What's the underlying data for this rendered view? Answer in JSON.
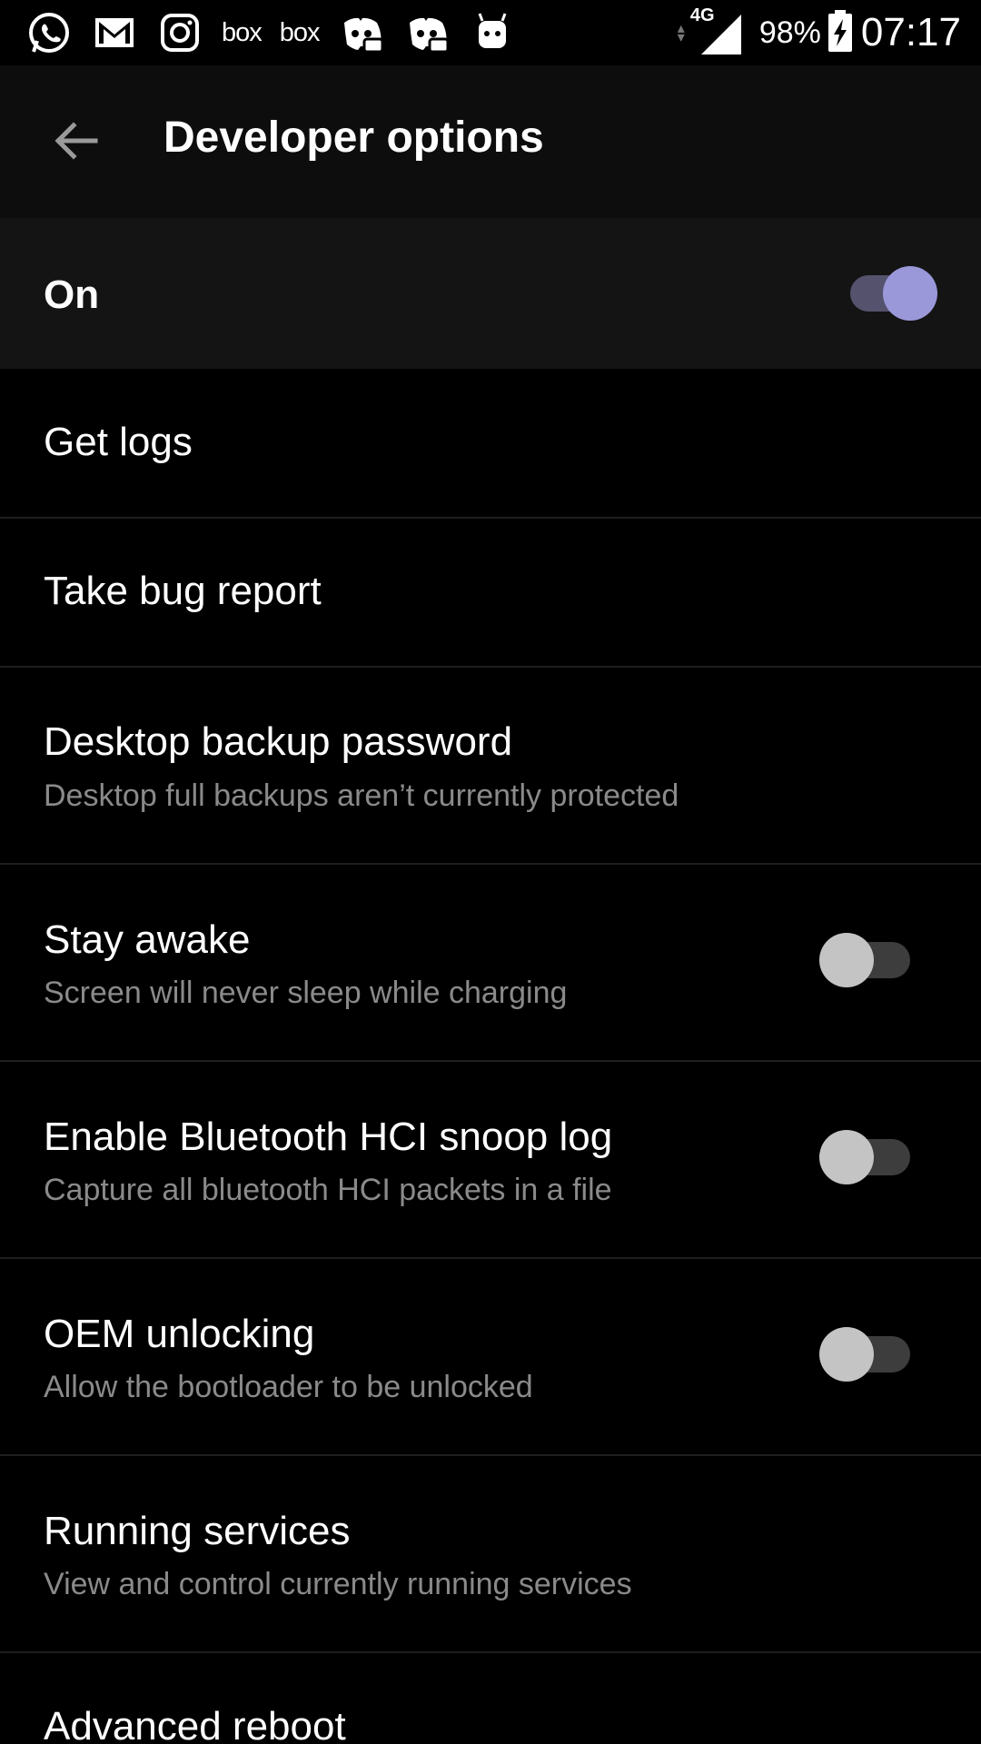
{
  "statusbar": {
    "notif_icons": [
      "whatsapp-icon",
      "gmail-icon",
      "instagram-icon",
      "box-icon",
      "box-icon",
      "discord-icon",
      "discord-icon",
      "android-icon"
    ],
    "box_label": "box",
    "network": "4G",
    "battery_percent": "98%",
    "time": "07:17"
  },
  "appbar": {
    "title": "Developer options"
  },
  "master": {
    "label": "On",
    "enabled": true
  },
  "items": [
    {
      "title": "Get logs"
    },
    {
      "title": "Take bug report"
    },
    {
      "title": "Desktop backup password",
      "summary": "Desktop full backups aren’t currently protected"
    },
    {
      "title": "Stay awake",
      "summary": "Screen will never sleep while charging",
      "enabled": false
    },
    {
      "title": "Enable Bluetooth HCI snoop log",
      "summary": "Capture all bluetooth HCI packets in a file",
      "enabled": false
    },
    {
      "title": "OEM unlocking",
      "summary": "Allow the bootloader to be unlocked",
      "enabled": false
    },
    {
      "title": "Running services",
      "summary": "View and control currently running services"
    },
    {
      "title": "Advanced reboot"
    }
  ],
  "colors": {
    "accent": "#9a98d8",
    "background": "#000000",
    "appbar": "#0d0d0d",
    "summary_text": "#8a8a8a"
  }
}
